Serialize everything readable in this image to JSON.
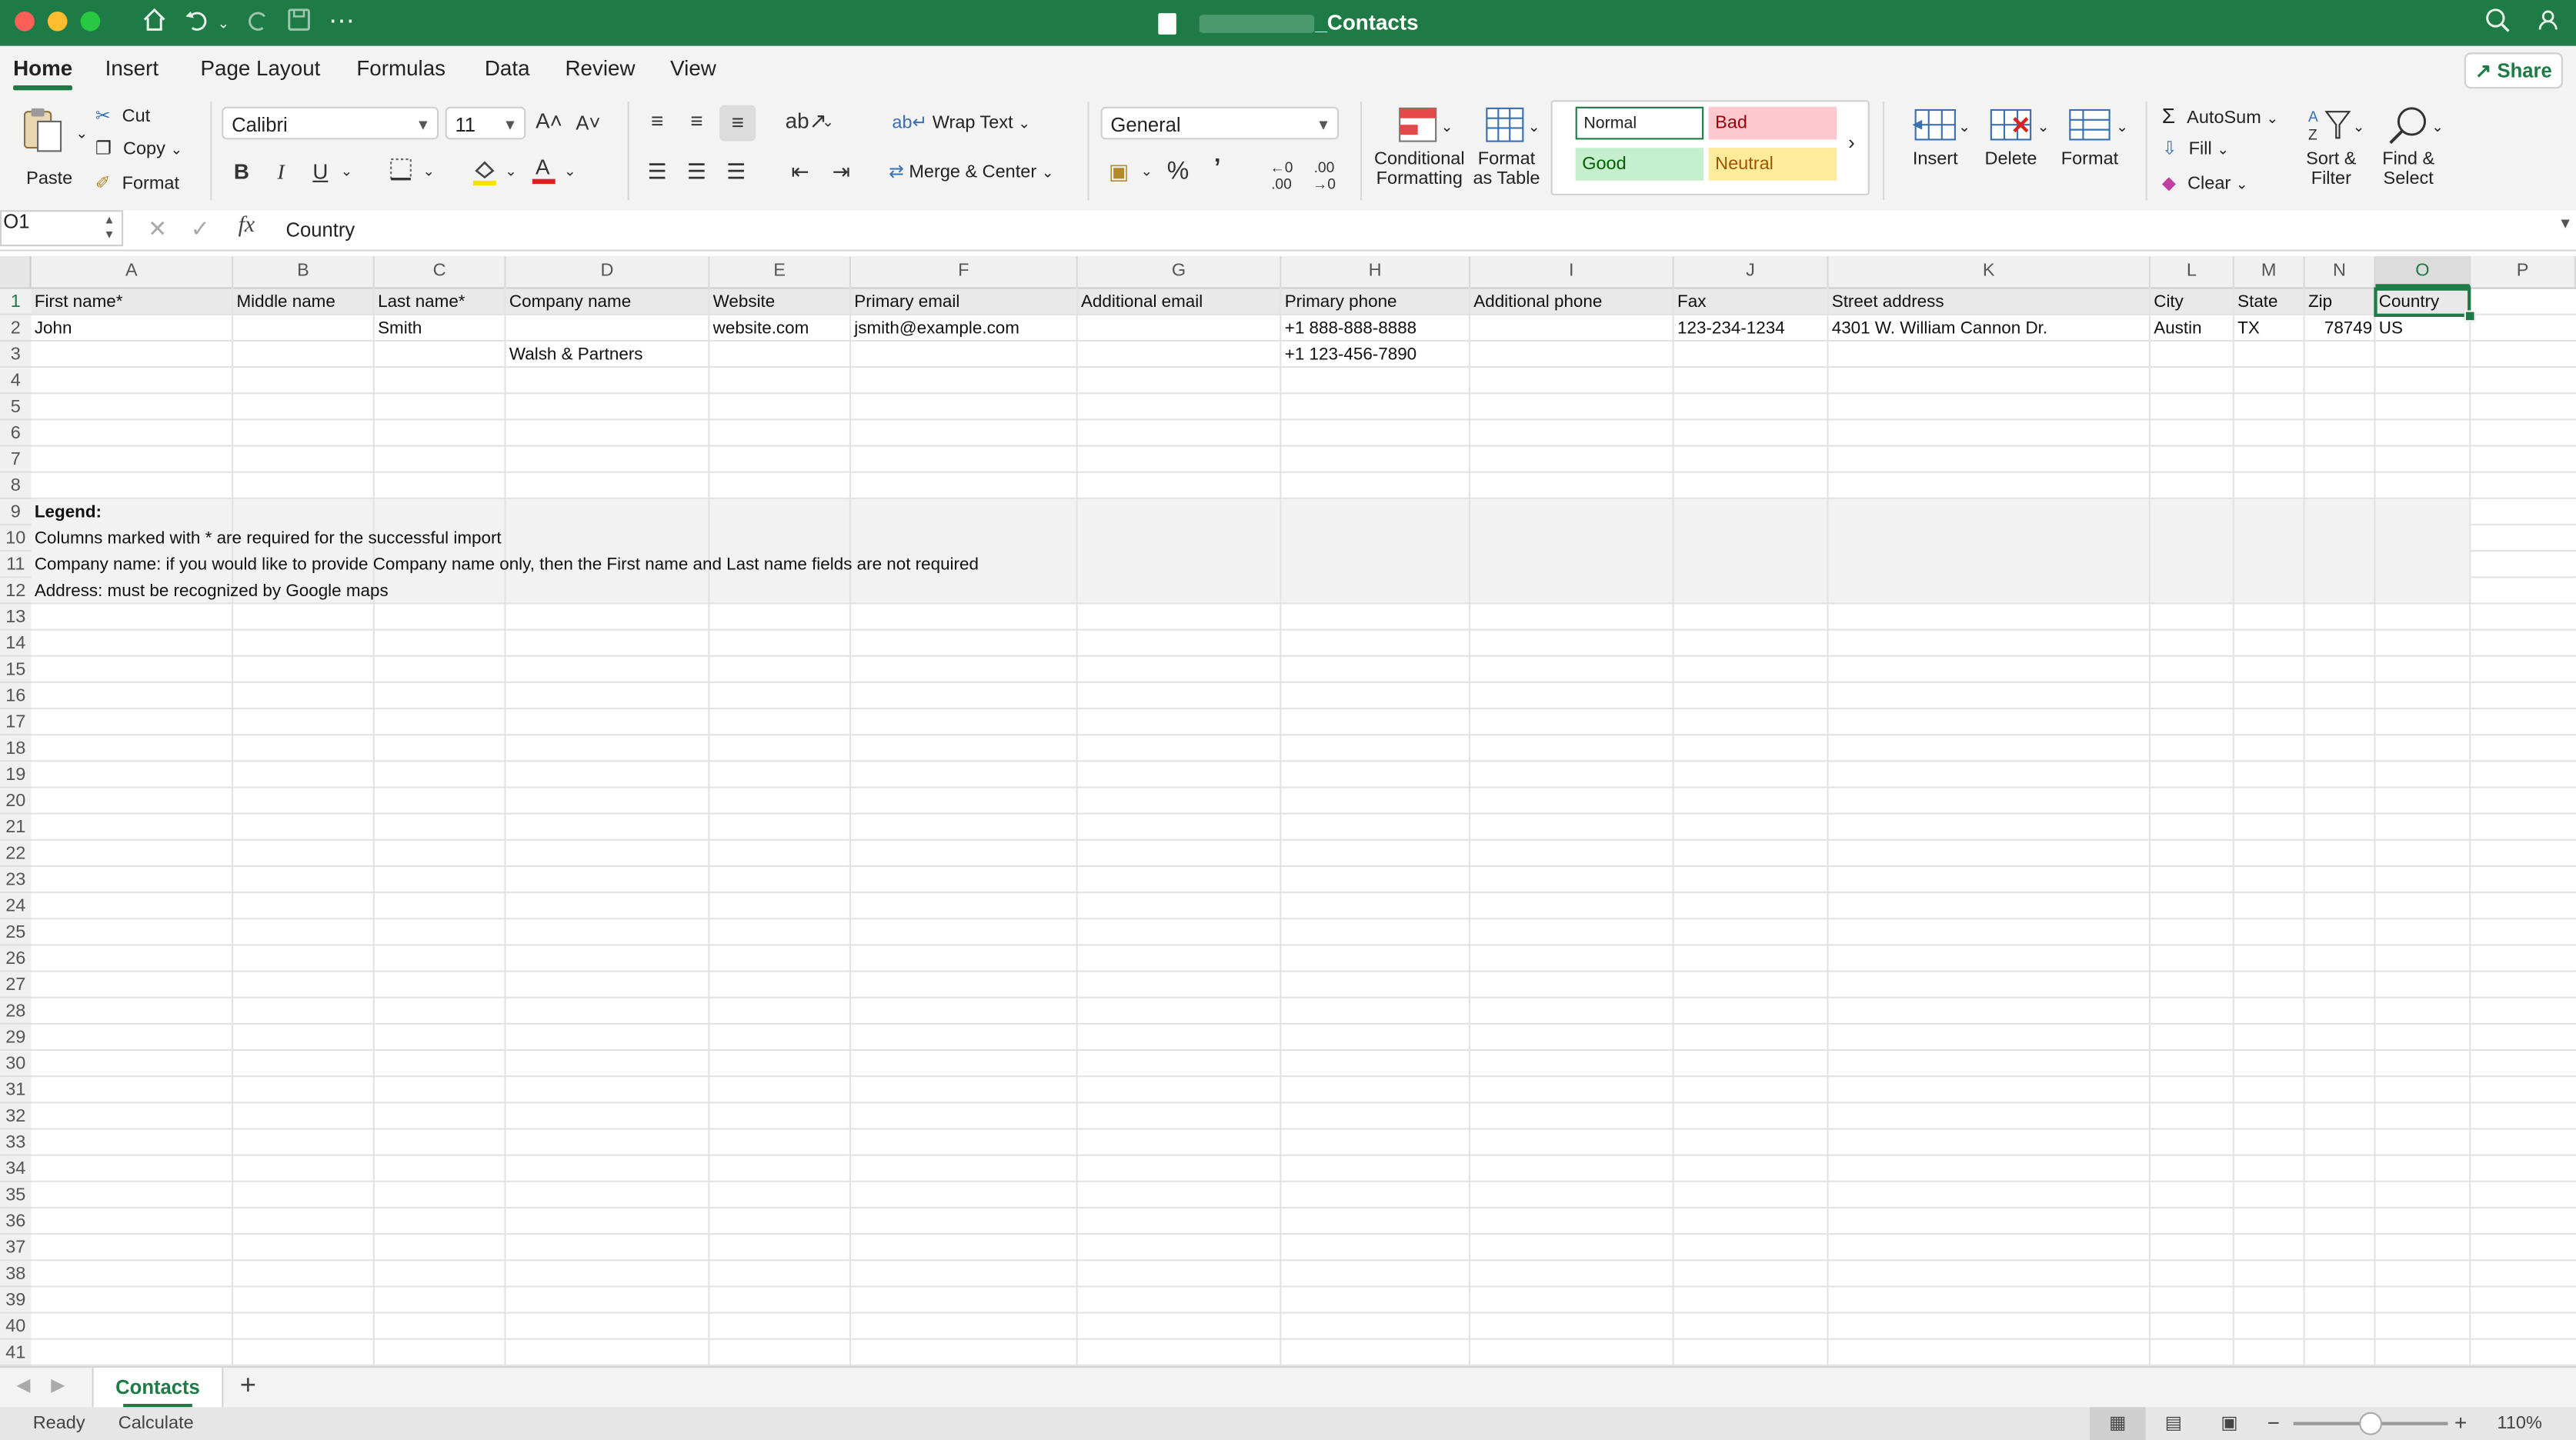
{
  "window": {
    "title_suffix": "_Contacts",
    "accent_color": "#1e7b45"
  },
  "quick_access": {
    "icons": [
      "home-icon",
      "undo-icon",
      "redo-icon",
      "save-icon",
      "more-icon"
    ],
    "more": "⋯"
  },
  "tabs": [
    "Home",
    "Insert",
    "Page Layout",
    "Formulas",
    "Data",
    "Review",
    "View"
  ],
  "active_tab": "Home",
  "share_label": "Share",
  "ribbon": {
    "clipboard": {
      "paste": "Paste",
      "cut": "Cut",
      "copy": "Copy",
      "format": "Format"
    },
    "font": {
      "name": "Calibri",
      "size": "11",
      "bold": "B",
      "italic": "I",
      "underline": "U"
    },
    "alignment": {
      "wrap_text": "Wrap Text",
      "merge_center": "Merge & Center"
    },
    "number": {
      "format": "General",
      "percent": "%",
      "comma": "9"
    },
    "styles": {
      "conditional_formatting_1": "Conditional",
      "conditional_formatting_2": "Formatting",
      "format_table_1": "Format",
      "format_table_2": "as Table",
      "normal": "Normal",
      "bad": "Bad",
      "good": "Good",
      "neutral": "Neutral"
    },
    "cells": {
      "insert": "Insert",
      "delete": "Delete",
      "format": "Format"
    },
    "editing": {
      "autosum": "AutoSum",
      "fill": "Fill",
      "clear": "Clear",
      "sort_filter_1": "Sort &",
      "sort_filter_2": "Filter",
      "find_select_1": "Find &",
      "find_select_2": "Select"
    }
  },
  "formula_bar": {
    "name_box": "O1",
    "fx": "fx",
    "content": "Country"
  },
  "columns": [
    "A",
    "B",
    "C",
    "D",
    "E",
    "F",
    "G",
    "H",
    "I",
    "J",
    "K",
    "L",
    "M",
    "N",
    "O",
    "P"
  ],
  "selected_column": "O",
  "rows_visible": 41,
  "cells": {
    "row1": [
      "First name*",
      "Middle name",
      "Last name*",
      "Company name",
      "Website",
      "Primary email",
      "Additional email",
      "Primary phone",
      "Additional phone",
      "Fax",
      "Street address",
      "City",
      "State",
      "Zip",
      "Country"
    ],
    "row2": {
      "A": "John",
      "C": "Smith",
      "E": "website.com",
      "F": "jsmith@example.com",
      "H": "+1 888-888-8888",
      "J": "123-234-1234",
      "K": "4301 W. William Cannon Dr.",
      "L": "Austin",
      "M": "TX",
      "N": "78749",
      "O": "US"
    },
    "row3": {
      "D": "Walsh & Partners",
      "H": "+1 123-456-7890"
    },
    "row9": "Legend:",
    "row10": "Columns marked with * are required for the successful import",
    "row11": "Company name: if you would like to provide Company name only, then the First name and Last name fields are not required",
    "row12": "Address: must be recognized by Google maps"
  },
  "sheets": [
    "Contacts"
  ],
  "add_sheet": "+",
  "status": {
    "ready": "Ready",
    "calculate": "Calculate",
    "zoom": "110%"
  }
}
